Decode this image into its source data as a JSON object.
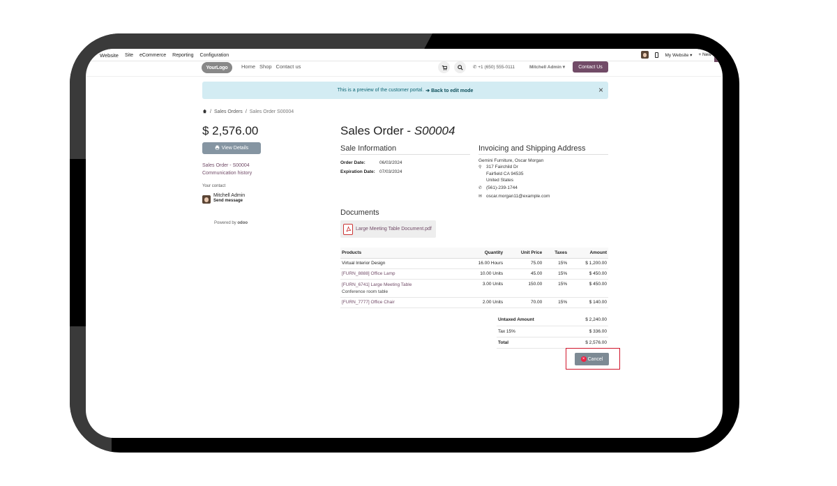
{
  "adminbar": {
    "brand": "Website",
    "menus": [
      "Site",
      "eCommerce",
      "Reporting",
      "Configuration"
    ],
    "my_website": "My Website ▾",
    "new": "+ New"
  },
  "sitenav": {
    "logo": "YourLogo",
    "links": [
      "Home",
      "Shop",
      "Contact us"
    ],
    "phone": "+1 (650) 555-0111",
    "user_menu": "Mitchell Admin ▾",
    "contact_button": "Contact Us"
  },
  "banner": {
    "text": "This is a preview of the customer portal.",
    "link": "➔ Back to edit mode",
    "close": "×"
  },
  "breadcrumb": {
    "home_icon": "home-icon",
    "items": [
      "Sales Orders",
      "Sales Order S00004"
    ],
    "sep": "/"
  },
  "sidebar": {
    "amount": "$ 2,576.00",
    "view_details": "View Details",
    "links": [
      "Sales Order - S00004",
      "Communication history"
    ],
    "your_contact": "Your contact",
    "contact_name": "Mitchell Admin",
    "send_message": "Send message",
    "powered_by": "Powered by",
    "odoo": "odoo"
  },
  "order": {
    "title_prefix": "Sales Order - ",
    "title_ref": "S00004",
    "sale_info_heading": "Sale Information",
    "order_date_label": "Order Date:",
    "order_date": "06/03/2024",
    "expiration_label": "Expiration Date:",
    "expiration": "07/03/2024",
    "address_heading": "Invoicing and Shipping Address",
    "customer": "Gemini Furniture, Oscar Morgan",
    "street": "317 Fairchild Dr",
    "city": "Fairfield CA 94535",
    "country": "United States",
    "phone": "(561)-239-1744",
    "email": "oscar.morgan11@example.com",
    "documents_heading": "Documents",
    "document": "Large Meeting Table Document.pdf"
  },
  "lines": {
    "headers": [
      "Products",
      "Quantity",
      "Unit Price",
      "Taxes",
      "Amount"
    ],
    "rows": [
      {
        "product": "Virtual Interior Design",
        "desc": "",
        "qty": "16.00 Hours",
        "price": "75.00",
        "tax": "15%",
        "amount": "$ 1,200.00"
      },
      {
        "product": "[FURN_8888] Office Lamp",
        "desc": "",
        "qty": "10.00 Units",
        "price": "45.00",
        "tax": "15%",
        "amount": "$ 450.00"
      },
      {
        "product": "[FURN_6741] Large Meeting Table",
        "desc": "Conference room table",
        "qty": "3.00 Units",
        "price": "150.00",
        "tax": "15%",
        "amount": "$ 450.00"
      },
      {
        "product": "[FURN_7777] Office Chair",
        "desc": "",
        "qty": "2.00 Units",
        "price": "70.00",
        "tax": "15%",
        "amount": "$ 140.00"
      }
    ]
  },
  "totals": {
    "untaxed_label": "Untaxed Amount",
    "untaxed": "$ 2,240.00",
    "tax_label": "Tax 15%",
    "tax": "$ 336.00",
    "total_label": "Total",
    "total": "$ 2,576.00"
  },
  "cancel": {
    "label": "Cancel",
    "icon": "×"
  },
  "colors": {
    "brand": "#714b67",
    "banner": "#d3ecf3",
    "highlight": "#d0142a",
    "button_grey": "#7d8a94"
  }
}
